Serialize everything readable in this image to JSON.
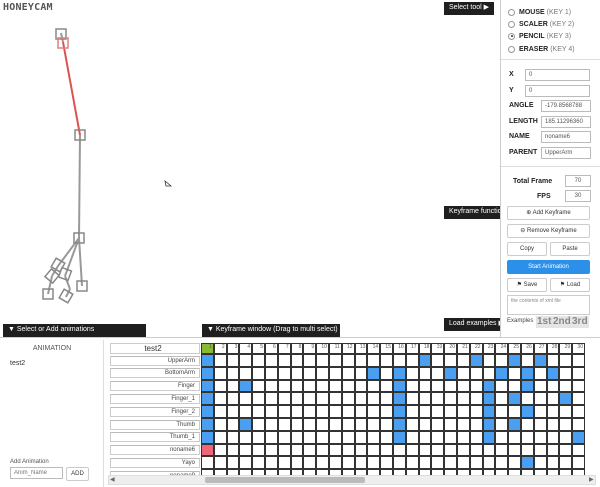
{
  "watermark": "HONEYCAM",
  "toolbar": {
    "select_tool": "Select tool",
    "keyframe_functions": "Keyframe functions",
    "load_examples": "Load examples",
    "select_animations": "Select or Add animations",
    "keyframe_window": "Keyframe window (Drag to multi select)"
  },
  "tools": [
    {
      "name": "MOUSE",
      "key": "(KEY 1)",
      "selected": false
    },
    {
      "name": "SCALER",
      "key": "(KEY 2)",
      "selected": false
    },
    {
      "name": "PENCIL",
      "key": "(KEY 3)",
      "selected": true
    },
    {
      "name": "ERASER",
      "key": "(KEY 4)",
      "selected": false
    }
  ],
  "props": {
    "x_label": "X",
    "x_value": "0",
    "y_label": "Y",
    "y_value": "0",
    "angle_label": "ANGLE",
    "angle_value": "-179.8568788",
    "length_label": "LENGTH",
    "length_value": "185.11296360",
    "name_label": "NAME",
    "name_value": "noname6",
    "parent_label": "PARENT",
    "parent_value": "UpperArm",
    "total_frame_label": "Total Frame",
    "total_frame_value": "70",
    "fps_label": "FPS",
    "fps_value": "30"
  },
  "buttons": {
    "add_keyframe": "⊕ Add Keyframe",
    "remove_keyframe": "⊖ Remove Keyframe",
    "copy": "Copy",
    "paste": "Paste",
    "start_animation": "Start Animation",
    "save": "Save",
    "load": "Load",
    "add": "ADD"
  },
  "file_text": "the contents of xml file",
  "examples": {
    "label": "Examples",
    "items": [
      "1st",
      "2nd",
      "3rd"
    ]
  },
  "animation": {
    "header": "ANIMATION",
    "items": [
      "test2"
    ],
    "add_label": "Add Animation",
    "name_placeholder": "Anim_Name"
  },
  "keyframes": {
    "active_animation": "test2",
    "layers": [
      "UpperArm",
      "BottomArm",
      "Finger",
      "Finger_1",
      "Finger_2",
      "Thumb",
      "Thumb_1",
      "noname6",
      "Yayo",
      "noname9"
    ],
    "frame_numbers": [
      "1",
      "2",
      "3",
      "4",
      "5",
      "6",
      "7",
      "8",
      "9",
      "10",
      "11",
      "12",
      "13",
      "14",
      "15",
      "16",
      "17",
      "18",
      "19",
      "20",
      "21",
      "22",
      "23",
      "24",
      "25",
      "26",
      "27",
      "28",
      "29",
      "30"
    ],
    "blue_cells": [
      [
        0,
        1
      ],
      [
        0,
        18
      ],
      [
        0,
        22
      ],
      [
        0,
        25
      ],
      [
        0,
        27
      ],
      [
        1,
        1
      ],
      [
        1,
        14
      ],
      [
        1,
        16
      ],
      [
        1,
        20
      ],
      [
        1,
        24
      ],
      [
        1,
        26
      ],
      [
        1,
        28
      ],
      [
        2,
        1
      ],
      [
        2,
        4
      ],
      [
        2,
        16
      ],
      [
        2,
        23
      ],
      [
        2,
        26
      ],
      [
        3,
        1
      ],
      [
        3,
        16
      ],
      [
        3,
        23
      ],
      [
        3,
        25
      ],
      [
        3,
        29
      ],
      [
        4,
        1
      ],
      [
        4,
        16
      ],
      [
        4,
        23
      ],
      [
        4,
        26
      ],
      [
        5,
        1
      ],
      [
        5,
        4
      ],
      [
        5,
        16
      ],
      [
        5,
        23
      ],
      [
        5,
        25
      ],
      [
        6,
        1
      ],
      [
        6,
        16
      ],
      [
        6,
        23
      ],
      [
        6,
        30
      ],
      [
        8,
        26
      ]
    ],
    "red_cells": [
      [
        7,
        1
      ]
    ],
    "green_header": [
      1
    ]
  }
}
